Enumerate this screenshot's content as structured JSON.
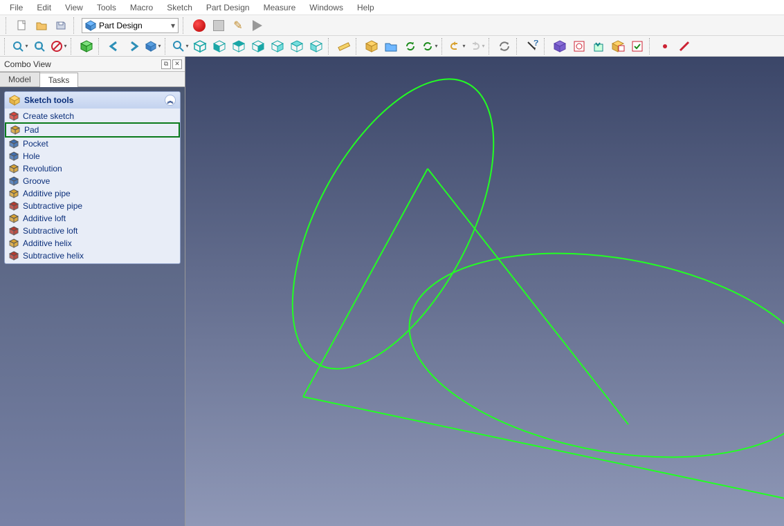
{
  "menubar": [
    "File",
    "Edit",
    "View",
    "Tools",
    "Macro",
    "Sketch",
    "Part Design",
    "Measure",
    "Windows",
    "Help"
  ],
  "workbench": {
    "label": "Part Design"
  },
  "panel": {
    "title": "Combo View",
    "dock": "⧉",
    "close": "✕"
  },
  "tabs": {
    "model": "Model",
    "tasks": "Tasks"
  },
  "task_header": "Sketch tools",
  "tools": [
    {
      "name": "create-sketch",
      "label": "Create sketch",
      "color": "#d9443a"
    },
    {
      "name": "pad",
      "label": "Pad",
      "color": "#d8a12f",
      "highlight": true
    },
    {
      "name": "pocket",
      "label": "Pocket",
      "color": "#3f6fb0"
    },
    {
      "name": "hole",
      "label": "Hole",
      "color": "#3f6fb0"
    },
    {
      "name": "revolution",
      "label": "Revolution",
      "color": "#d8a12f"
    },
    {
      "name": "groove",
      "label": "Groove",
      "color": "#3f6fb0"
    },
    {
      "name": "additive-pipe",
      "label": "Additive pipe",
      "color": "#d8a12f"
    },
    {
      "name": "subtractive-pipe",
      "label": "Subtractive pipe",
      "color": "#b63a2f"
    },
    {
      "name": "additive-loft",
      "label": "Additive loft",
      "color": "#d8a12f"
    },
    {
      "name": "subtractive-loft",
      "label": "Subtractive loft",
      "color": "#b63a2f"
    },
    {
      "name": "additive-helix",
      "label": "Additive helix",
      "color": "#d8a12f"
    },
    {
      "name": "subtractive-helix",
      "label": "Subtractive helix",
      "color": "#b63a2f"
    }
  ]
}
